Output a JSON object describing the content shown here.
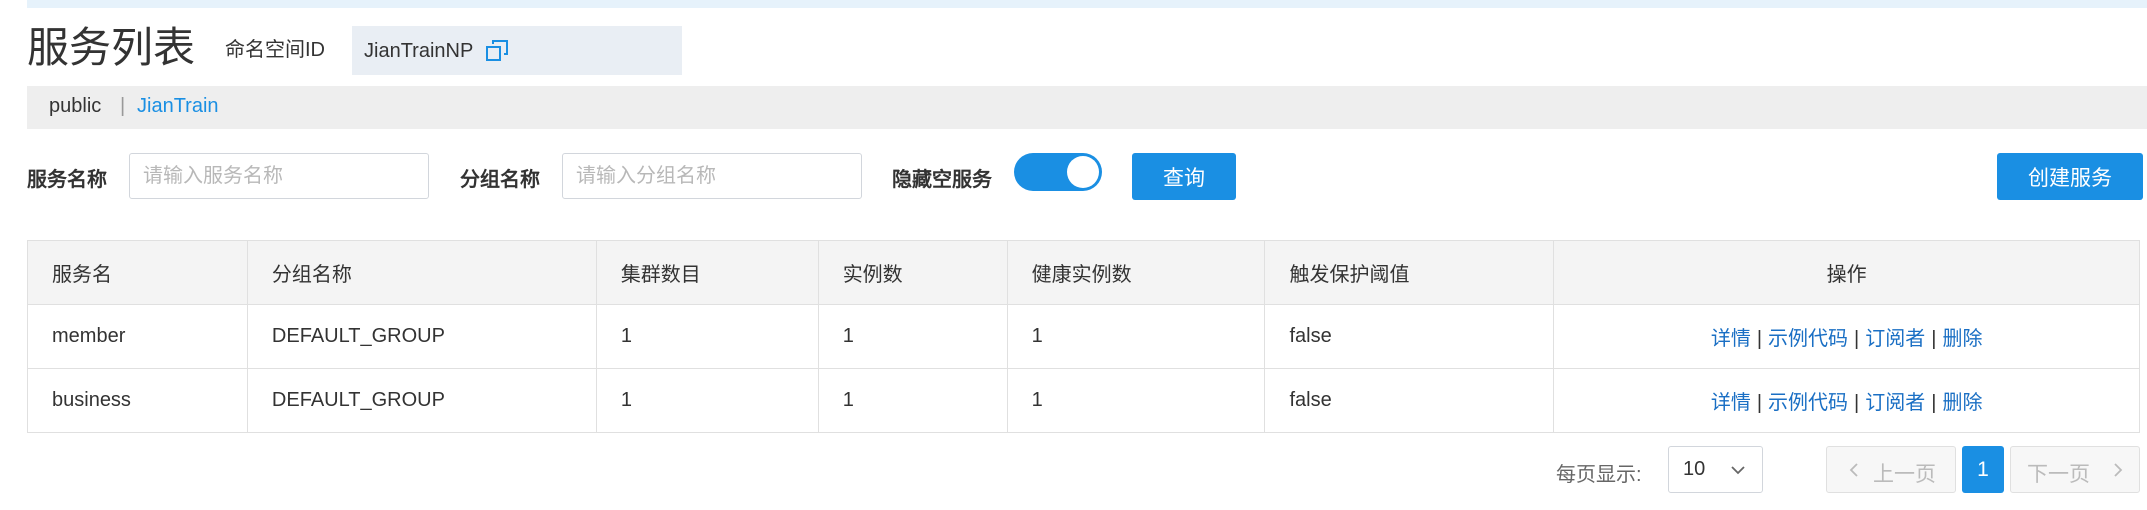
{
  "header": {
    "title": "服务列表",
    "namespace_label": "命名空间ID",
    "namespace_value": "JianTrainNP"
  },
  "namespaces": {
    "items": [
      "public",
      "JianTrain"
    ],
    "separator": "|",
    "active": "JianTrain"
  },
  "filters": {
    "service_name_label": "服务名称",
    "service_name_placeholder": "请输入服务名称",
    "group_name_label": "分组名称",
    "group_name_placeholder": "请输入分组名称",
    "hide_empty_label": "隐藏空服务",
    "hide_empty_enabled": true,
    "query_button": "查询",
    "create_button": "创建服务"
  },
  "table": {
    "columns": [
      "服务名",
      "分组名称",
      "集群数目",
      "实例数",
      "健康实例数",
      "触发保护阈值",
      "操作"
    ],
    "rows": [
      [
        "member",
        "DEFAULT_GROUP",
        "1",
        "1",
        "1",
        "false"
      ],
      [
        "business",
        "DEFAULT_GROUP",
        "1",
        "1",
        "1",
        "false"
      ]
    ],
    "actions": [
      "详情",
      "示例代码",
      "订阅者",
      "删除"
    ],
    "action_separator": "|"
  },
  "pagination": {
    "page_size_label": "每页显示:",
    "page_size": "10",
    "prev_label": "上一页",
    "next_label": "下一页",
    "current_page": "1"
  },
  "colors": {
    "accent": "#1a8fe3",
    "link": "#1a6fc4",
    "header_bg": "#f4f4f4",
    "namespace_bar_bg": "#eeeeee",
    "top_strip": "#e6f2fb"
  },
  "icons": [
    "copy-icon",
    "chevron-left-icon",
    "chevron-right-icon",
    "chevron-down-icon"
  ]
}
